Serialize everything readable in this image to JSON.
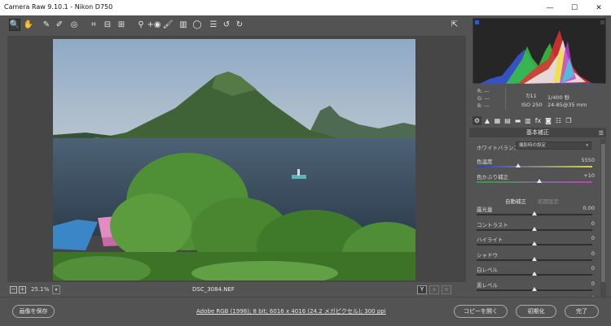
{
  "window": {
    "title": "Camera Raw 9.10.1  -  Nikon D750",
    "minimize": "—",
    "maximize": "☐",
    "close": "✕"
  },
  "toolbar": {
    "tools": [
      {
        "name": "zoom-tool",
        "glyph": "🔍",
        "active": true
      },
      {
        "name": "hand-tool",
        "glyph": "✋"
      },
      {
        "name": "white-balance-tool",
        "glyph": "✎"
      },
      {
        "name": "color-sampler-tool",
        "glyph": "✐"
      },
      {
        "name": "targeted-adjustment-tool",
        "glyph": "◎"
      },
      {
        "name": "crop-tool",
        "glyph": "⌗"
      },
      {
        "name": "straighten-tool",
        "glyph": "⊟"
      },
      {
        "name": "transform-tool",
        "glyph": "⊞"
      },
      {
        "name": "spot-removal-tool",
        "glyph": "⚲"
      },
      {
        "name": "red-eye-tool",
        "glyph": "+◉"
      },
      {
        "name": "adjustment-brush-tool",
        "glyph": "🖌"
      },
      {
        "name": "graduated-filter-tool",
        "glyph": "▥"
      },
      {
        "name": "radial-filter-tool",
        "glyph": "◯"
      },
      {
        "name": "preferences-tool",
        "glyph": "☰"
      },
      {
        "name": "rotate-left-tool",
        "glyph": "↺"
      },
      {
        "name": "rotate-right-tool",
        "glyph": "↻"
      }
    ],
    "fullscreen_glyph": "⇱"
  },
  "statusbar": {
    "zoom": "25.1%",
    "zoom_minus": "−",
    "zoom_plus": "+",
    "zoom_arrow": "▾",
    "filename": "DSC_3084.NEF",
    "view_y": "Y",
    "view_b1": "±",
    "view_b2": "≡"
  },
  "info": {
    "r_label": "R:",
    "r_value": "---",
    "g_label": "G:",
    "g_value": "---",
    "b_label": "B:",
    "b_value": "---",
    "aperture": "f/11",
    "shutter": "1/400 秒",
    "iso": "ISO 250",
    "lens": "24-85@35 mm"
  },
  "panel_tabs": [
    "⚙",
    "▲",
    "▦",
    "▤",
    "▬",
    "▥",
    "fx",
    "◙",
    "☷",
    "❐"
  ],
  "section": {
    "title": "基本補正",
    "menu_glyph": "☰"
  },
  "white_balance": {
    "label": "ホワイトバランス :",
    "value": "撮影時の設定",
    "arrow": "▾"
  },
  "sliders_top": [
    {
      "label": "色温度",
      "value": "5550",
      "pos": 0.36,
      "track": "temp"
    },
    {
      "label": "色かぶり補正",
      "value": "+10",
      "pos": 0.54,
      "track": "tint"
    }
  ],
  "auto": {
    "auto_label": "自動補正",
    "default_label": "初期設定"
  },
  "sliders": [
    {
      "label": "露光量",
      "value": "0.00",
      "pos": 0.5
    },
    {
      "label": "コントラスト",
      "value": "0",
      "pos": 0.5
    },
    {
      "label": "ハイライト",
      "value": "0",
      "pos": 0.5
    },
    {
      "label": "シャドウ",
      "value": "0",
      "pos": 0.5
    },
    {
      "label": "白レベル",
      "value": "0",
      "pos": 0.5
    },
    {
      "label": "黒レベル",
      "value": "0",
      "pos": 0.5
    },
    {
      "label": "明瞭度",
      "value": "0",
      "pos": 0.5
    }
  ],
  "bottom": {
    "save": "画像を保存",
    "workflow": "Adobe RGB (1998); 8 bit; 6016 x 4016 (24.2 メガピクセル); 300 ppi",
    "open": "コピーを開く",
    "reset": "初期化",
    "done": "完了"
  }
}
